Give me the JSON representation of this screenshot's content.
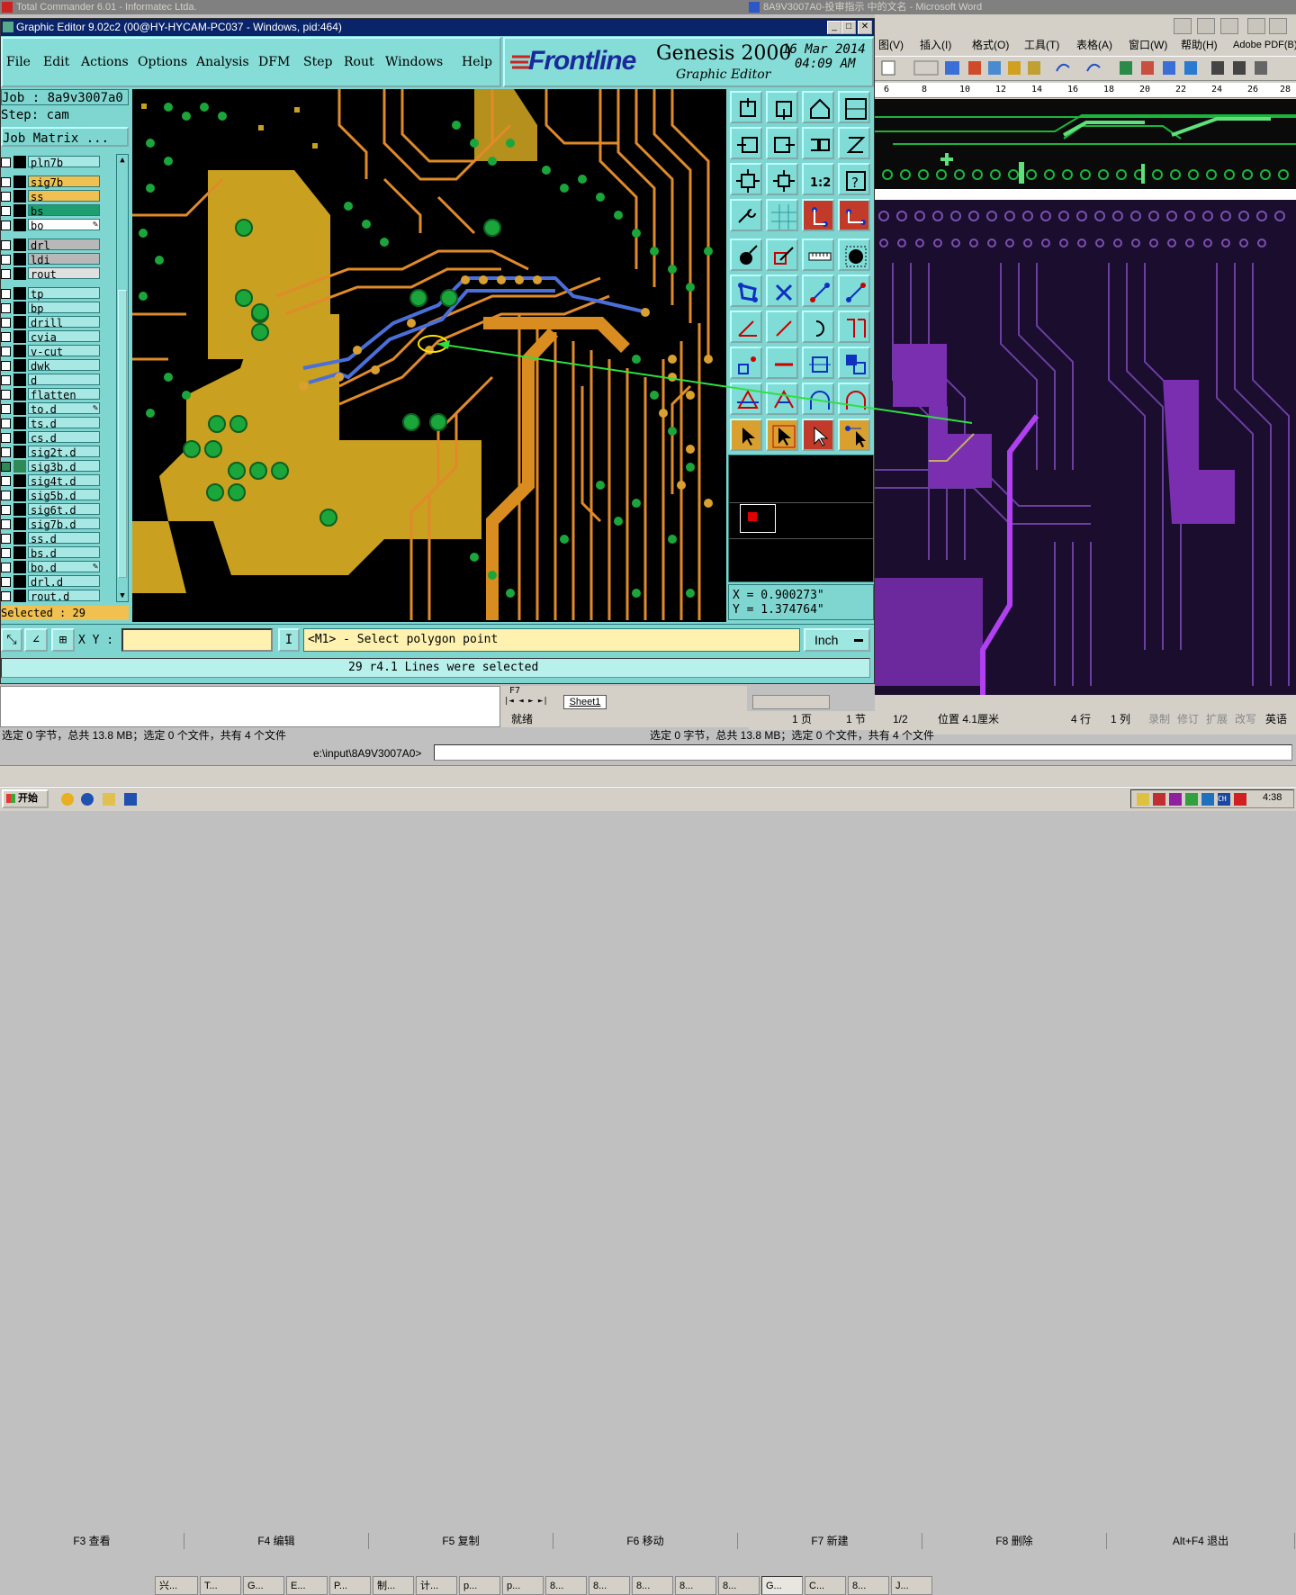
{
  "tc_title": "Total Commander 6.01 - Informatec Ltda.",
  "word_title": "8A9V3007A0-投审指示 中的文名 - Microsoft Word",
  "ge": {
    "title": "Graphic Editor 9.02c2 (00@HY-HYCAM-PC037 - Windows, pid:464)",
    "menu": [
      "File",
      "Edit",
      "Actions",
      "Options",
      "Analysis",
      "DFM",
      "Step",
      "Rout",
      "Windows",
      "Help"
    ],
    "logo": "Frontline",
    "product": "Genesis 2000",
    "subtitle": "Graphic Editor",
    "date": "16 Mar 2014",
    "time": "04:09 AM",
    "job": "Job : 8a9v3007a0",
    "step": "Step: cam",
    "job_matrix": "Job Matrix ...",
    "layers": [
      {
        "name": "pln7b",
        "color": "#a8e8e4",
        "on": false
      },
      {
        "name": "sig7b",
        "color": "#f0c050",
        "on": false
      },
      {
        "name": "ss",
        "color": "#f0c050",
        "on": false
      },
      {
        "name": "bs",
        "color": "#1f9f6f",
        "on": false
      },
      {
        "name": "bo",
        "color": "#ffffff",
        "on": false,
        "mark": true
      },
      {
        "name": "drl",
        "color": "#b8b8b8",
        "on": false
      },
      {
        "name": "ldi",
        "color": "#b8b8b8",
        "on": false
      },
      {
        "name": "rout",
        "color": "#e0e0e0",
        "on": false
      },
      {
        "name": "tp",
        "color": "#a8e8e4",
        "on": false
      },
      {
        "name": "bp",
        "color": "#a8e8e4",
        "on": false
      },
      {
        "name": "drill",
        "color": "#a8e8e4",
        "on": false
      },
      {
        "name": "cvia",
        "color": "#a8e8e4",
        "on": false
      },
      {
        "name": "v-cut",
        "color": "#a8e8e4",
        "on": false
      },
      {
        "name": "dwk",
        "color": "#a8e8e4",
        "on": false
      },
      {
        "name": "d",
        "color": "#a8e8e4",
        "on": false
      },
      {
        "name": "flatten",
        "color": "#a8e8e4",
        "on": false
      },
      {
        "name": "to.d",
        "color": "#a8e8e4",
        "on": false,
        "mark": true
      },
      {
        "name": "ts.d",
        "color": "#a8e8e4",
        "on": false
      },
      {
        "name": "cs.d",
        "color": "#a8e8e4",
        "on": false
      },
      {
        "name": "sig2t.d",
        "color": "#a8e8e4",
        "on": false
      },
      {
        "name": "sig3b.d",
        "color": "#a8e8e4",
        "on": true
      },
      {
        "name": "sig4t.d",
        "color": "#a8e8e4",
        "on": false
      },
      {
        "name": "sig5b.d",
        "color": "#a8e8e4",
        "on": false
      },
      {
        "name": "sig6t.d",
        "color": "#a8e8e4",
        "on": false
      },
      {
        "name": "sig7b.d",
        "color": "#a8e8e4",
        "on": false
      },
      {
        "name": "ss.d",
        "color": "#a8e8e4",
        "on": false
      },
      {
        "name": "bs.d",
        "color": "#a8e8e4",
        "on": false
      },
      {
        "name": "bo.d",
        "color": "#a8e8e4",
        "on": false,
        "mark": true
      },
      {
        "name": "drl.d",
        "color": "#a8e8e4",
        "on": false
      },
      {
        "name": "rout.d",
        "color": "#a8e8e4",
        "on": false
      }
    ],
    "selected": "Selected : 29",
    "x_coord": "X = 0.900273\"",
    "y_coord": "Y = 1.374764\"",
    "xy_label": "X Y :",
    "xy_value": "",
    "prompt": "<M1> - Select polygon point",
    "units": "Inch",
    "status": "29 r4.1 Lines were selected"
  },
  "tc": {
    "status_left": "选定 0 字节，总共 13.8 MB；选定 0 个文件，共有 4 个文件",
    "status_right": "选定 0 字节，总共 13.8 MB；选定 0 个文件，共有 4 个文件",
    "path": "e:\\input\\8A9V3007A0>",
    "fkeys": [
      "F3 查看",
      "F4 编辑",
      "F5 复制",
      "F6 移动",
      "F7 新建",
      "F8 删除",
      "Alt+F4 退出"
    ]
  },
  "excel": {
    "sheet": "Sheet1",
    "ready": "就绪",
    "cell": "F7"
  },
  "word": {
    "menu": [
      "图(V)",
      "插入(I)",
      "格式(O)",
      "工具(T)",
      "表格(A)",
      "窗口(W)",
      "帮助(H)",
      "Adobe PDF(B)"
    ],
    "ruler": [
      "6",
      "8",
      "10",
      "12",
      "14",
      "16",
      "18",
      "20",
      "22",
      "24",
      "26",
      "28"
    ],
    "status": [
      "1 页",
      "1 节",
      "1/2",
      "位置 4.1厘米",
      "4 行",
      "1 列",
      "录制",
      "修订",
      "扩展",
      "改写",
      "英语"
    ]
  },
  "taskbar": {
    "start": "开始",
    "items": [
      "兴...",
      "T...",
      "G...",
      "E...",
      "P...",
      "制...",
      "计...",
      "p...",
      "p...",
      "8...",
      "8...",
      "8...",
      "8...",
      "8...",
      "G...",
      "C...",
      "8...",
      "J..."
    ],
    "clock": "4:38"
  }
}
